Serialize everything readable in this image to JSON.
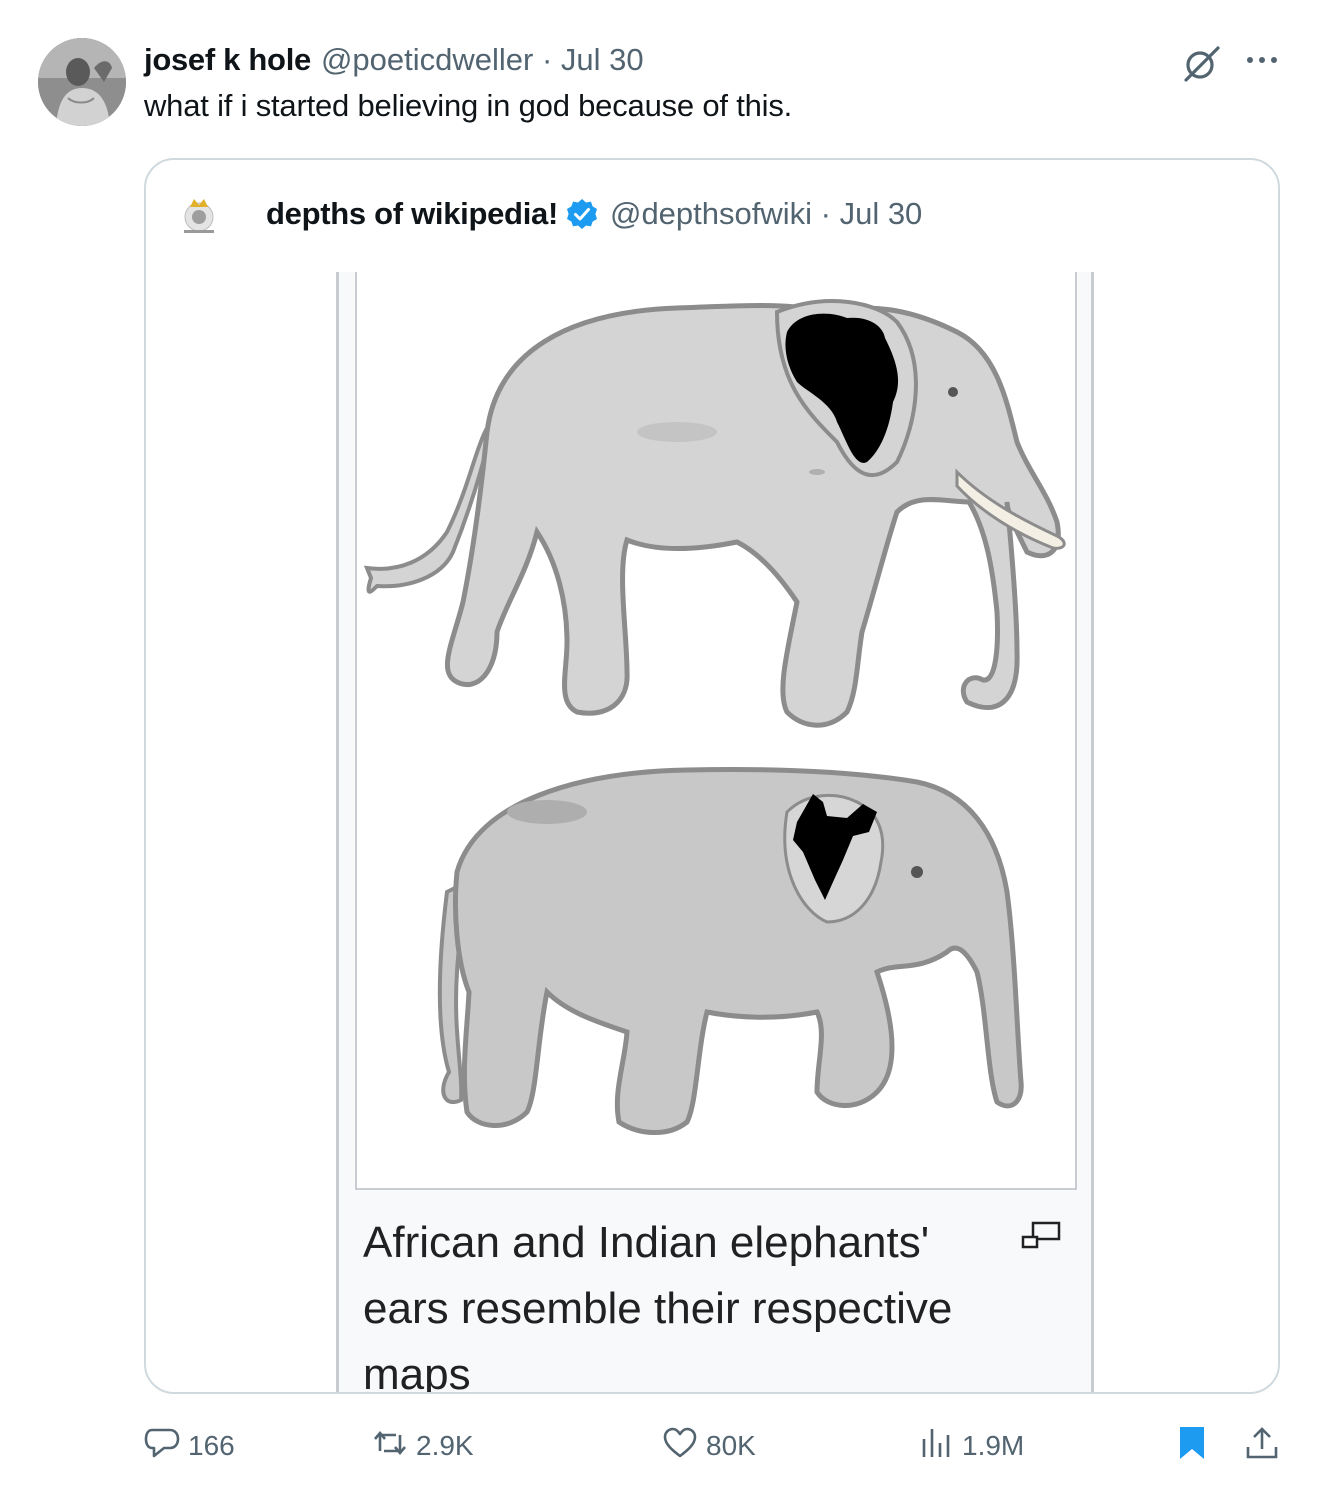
{
  "tweet": {
    "author_name": "josef k hole",
    "meta": "@poeticdweller · Jul 30",
    "text": "what if i started believing in god because of this."
  },
  "quote": {
    "author_name": "depths of wikipedia!",
    "meta": "@depthsofwiki · Jul 30",
    "caption": "African and Indian elephants' ears resemble their respective maps"
  },
  "actions": {
    "replies": "166",
    "reposts": "2.9K",
    "likes": "80K",
    "views": "1.9M"
  },
  "icons": [
    "grok-icon",
    "more-icon",
    "verified-badge-icon",
    "enlarge-icon",
    "reply-icon",
    "repost-icon",
    "like-icon",
    "views-icon",
    "bookmark-icon",
    "share-icon"
  ],
  "colors": {
    "text": "#0f1419",
    "secondary": "#536471",
    "verified": "#1d9bf0",
    "bookmark": "#1d9bf0",
    "card_border": "#cfd9de"
  }
}
